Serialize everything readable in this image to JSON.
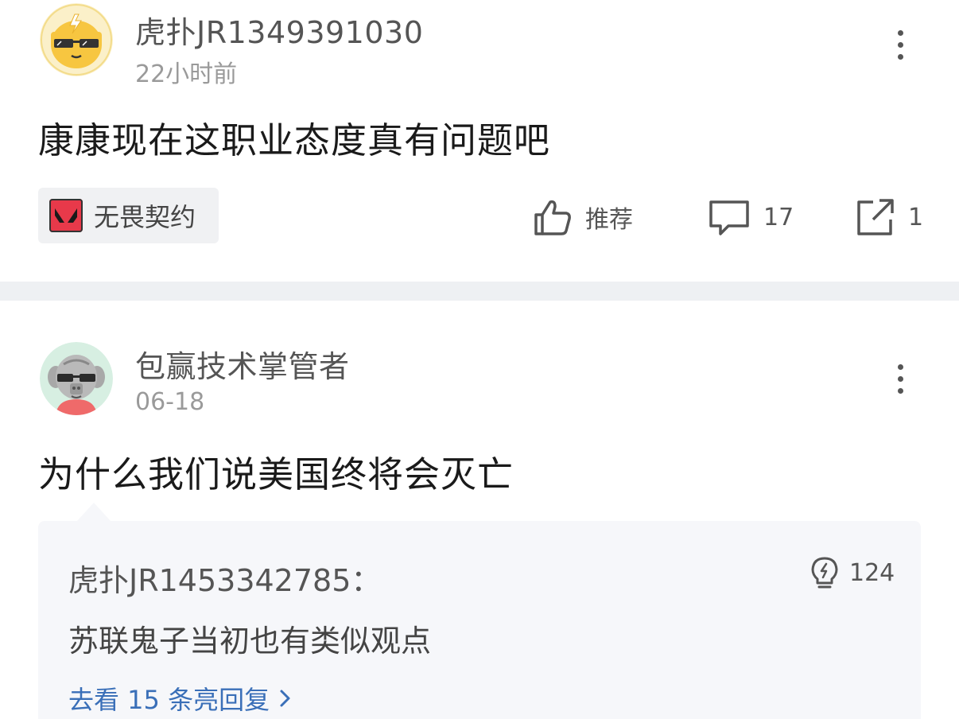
{
  "posts": [
    {
      "username": "虎扑JR1349391030",
      "time": "22小时前",
      "title": "康康现在这职业态度真有问题吧",
      "tag": "无畏契约",
      "actions": {
        "recommend_label": "推荐",
        "comment_count": "17",
        "share_count": "1"
      },
      "avatar_icon": "sunglasses-emoji-avatar"
    },
    {
      "username": "包赢技术掌管者",
      "time": "06-18",
      "title": "为什么我们说美国终将会灭亡",
      "avatar_icon": "elephant-sunglasses-avatar",
      "reply": {
        "user": "虎扑JR1453342785：",
        "light_count": "124",
        "text": "苏联鬼子当初也有类似观点",
        "link": "去看 15 条亮回复"
      }
    }
  ],
  "colors": {
    "separator": "#eef0f3",
    "reply_bg": "#f6f7fa",
    "link_blue": "#3a6fb8",
    "tag_bg": "#f0f1f3",
    "valorant_red": "#e8394a"
  }
}
